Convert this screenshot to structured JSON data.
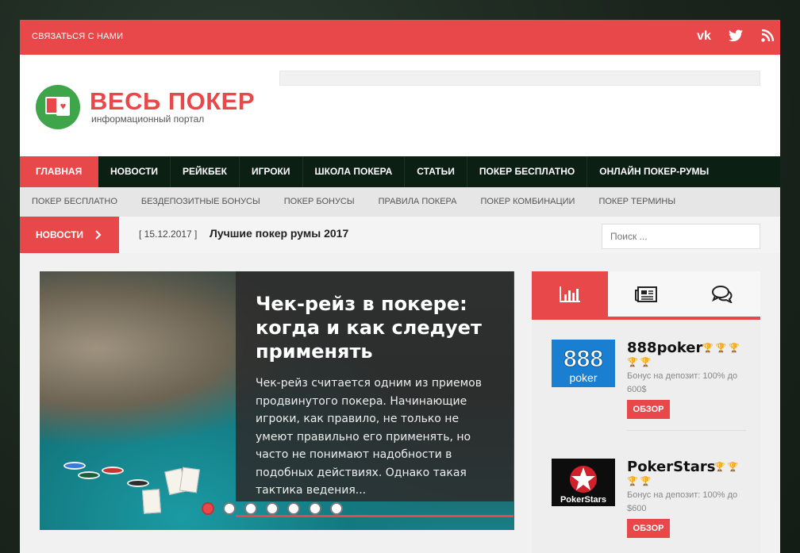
{
  "topbar": {
    "contact": "Связаться с нами",
    "social": [
      {
        "icon": "vk-icon",
        "glyph": "vk"
      },
      {
        "icon": "twitter-icon",
        "glyph": "t"
      },
      {
        "icon": "rss-icon",
        "glyph": "rss"
      }
    ]
  },
  "header": {
    "logo_title": "ВЕСЬ ПОКЕР",
    "logo_subtitle": "информационный портал"
  },
  "main_nav": [
    "Главная",
    "Новости",
    "Рейкбек",
    "Игроки",
    "Школа покера",
    "Статьи",
    "Покер бесплатно",
    "Онлайн покер-румы"
  ],
  "sub_nav": [
    "Покер бесплатно",
    "Бездепозитные бонусы",
    "Покер бонусы",
    "Правила покера",
    "Покер комбинации",
    "Покер термины"
  ],
  "ticker": {
    "label": "Новости",
    "date": "[ 15.12.2017 ]",
    "headline": "Лучшие покер румы 2017"
  },
  "search": {
    "placeholder": "Поиск ..."
  },
  "slider": {
    "title": "Чек-рейз в покере: когда и как следует применять",
    "excerpt": "Чек-рейз считается одним из приемов продвинутого покера. Начинающие игроки, как правило, не только не умеют правильно его применять, но часто не понимают надобности в подобных действиях. Однако такая тактика ведения...",
    "dot_count": 7,
    "active_dot": 1
  },
  "sidebar": {
    "tabs": [
      {
        "icon": "bar-chart-icon",
        "active": true
      },
      {
        "icon": "newspaper-icon",
        "active": false
      },
      {
        "icon": "comments-icon",
        "active": false
      }
    ],
    "rooms": [
      {
        "name": "888poker",
        "logo_text": "888",
        "logo_sub": "poker",
        "cups": 5,
        "bonus": "Бонус на депозит: 100% до 600$",
        "button": "Обзор"
      },
      {
        "name": "PokerStars",
        "logo_text": "♠",
        "logo_sub": "PokerStars",
        "cups": 4,
        "bonus": "Бонус на депозит: 100% до $600",
        "button": "Обзор"
      }
    ]
  },
  "colors": {
    "accent": "#e8484a",
    "nav_bg": "#0b1f12",
    "subnav_bg": "#e6e6e6"
  }
}
